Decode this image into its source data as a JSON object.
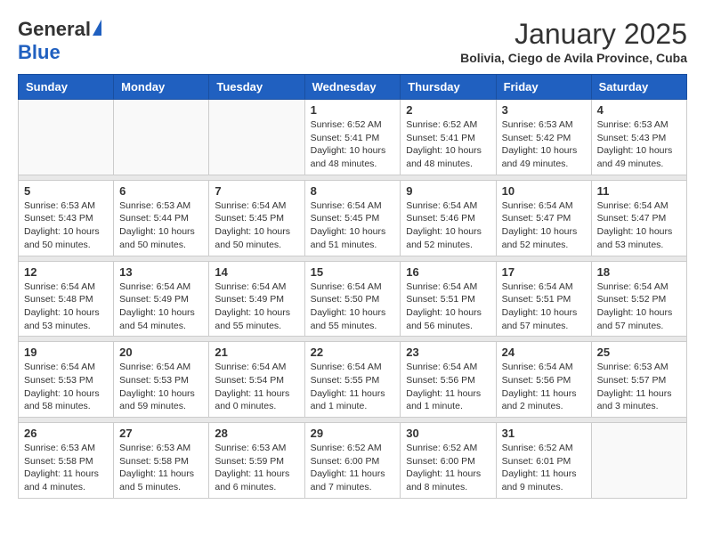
{
  "logo": {
    "general": "General",
    "blue": "Blue"
  },
  "title": "January 2025",
  "subtitle": "Bolivia, Ciego de Avila Province, Cuba",
  "headers": [
    "Sunday",
    "Monday",
    "Tuesday",
    "Wednesday",
    "Thursday",
    "Friday",
    "Saturday"
  ],
  "weeks": [
    {
      "days": [
        {
          "num": "",
          "info": ""
        },
        {
          "num": "",
          "info": ""
        },
        {
          "num": "",
          "info": ""
        },
        {
          "num": "1",
          "info": "Sunrise: 6:52 AM\nSunset: 5:41 PM\nDaylight: 10 hours\nand 48 minutes."
        },
        {
          "num": "2",
          "info": "Sunrise: 6:52 AM\nSunset: 5:41 PM\nDaylight: 10 hours\nand 48 minutes."
        },
        {
          "num": "3",
          "info": "Sunrise: 6:53 AM\nSunset: 5:42 PM\nDaylight: 10 hours\nand 49 minutes."
        },
        {
          "num": "4",
          "info": "Sunrise: 6:53 AM\nSunset: 5:43 PM\nDaylight: 10 hours\nand 49 minutes."
        }
      ]
    },
    {
      "days": [
        {
          "num": "5",
          "info": "Sunrise: 6:53 AM\nSunset: 5:43 PM\nDaylight: 10 hours\nand 50 minutes."
        },
        {
          "num": "6",
          "info": "Sunrise: 6:53 AM\nSunset: 5:44 PM\nDaylight: 10 hours\nand 50 minutes."
        },
        {
          "num": "7",
          "info": "Sunrise: 6:54 AM\nSunset: 5:45 PM\nDaylight: 10 hours\nand 50 minutes."
        },
        {
          "num": "8",
          "info": "Sunrise: 6:54 AM\nSunset: 5:45 PM\nDaylight: 10 hours\nand 51 minutes."
        },
        {
          "num": "9",
          "info": "Sunrise: 6:54 AM\nSunset: 5:46 PM\nDaylight: 10 hours\nand 52 minutes."
        },
        {
          "num": "10",
          "info": "Sunrise: 6:54 AM\nSunset: 5:47 PM\nDaylight: 10 hours\nand 52 minutes."
        },
        {
          "num": "11",
          "info": "Sunrise: 6:54 AM\nSunset: 5:47 PM\nDaylight: 10 hours\nand 53 minutes."
        }
      ]
    },
    {
      "days": [
        {
          "num": "12",
          "info": "Sunrise: 6:54 AM\nSunset: 5:48 PM\nDaylight: 10 hours\nand 53 minutes."
        },
        {
          "num": "13",
          "info": "Sunrise: 6:54 AM\nSunset: 5:49 PM\nDaylight: 10 hours\nand 54 minutes."
        },
        {
          "num": "14",
          "info": "Sunrise: 6:54 AM\nSunset: 5:49 PM\nDaylight: 10 hours\nand 55 minutes."
        },
        {
          "num": "15",
          "info": "Sunrise: 6:54 AM\nSunset: 5:50 PM\nDaylight: 10 hours\nand 55 minutes."
        },
        {
          "num": "16",
          "info": "Sunrise: 6:54 AM\nSunset: 5:51 PM\nDaylight: 10 hours\nand 56 minutes."
        },
        {
          "num": "17",
          "info": "Sunrise: 6:54 AM\nSunset: 5:51 PM\nDaylight: 10 hours\nand 57 minutes."
        },
        {
          "num": "18",
          "info": "Sunrise: 6:54 AM\nSunset: 5:52 PM\nDaylight: 10 hours\nand 57 minutes."
        }
      ]
    },
    {
      "days": [
        {
          "num": "19",
          "info": "Sunrise: 6:54 AM\nSunset: 5:53 PM\nDaylight: 10 hours\nand 58 minutes."
        },
        {
          "num": "20",
          "info": "Sunrise: 6:54 AM\nSunset: 5:53 PM\nDaylight: 10 hours\nand 59 minutes."
        },
        {
          "num": "21",
          "info": "Sunrise: 6:54 AM\nSunset: 5:54 PM\nDaylight: 11 hours\nand 0 minutes."
        },
        {
          "num": "22",
          "info": "Sunrise: 6:54 AM\nSunset: 5:55 PM\nDaylight: 11 hours\nand 1 minute."
        },
        {
          "num": "23",
          "info": "Sunrise: 6:54 AM\nSunset: 5:56 PM\nDaylight: 11 hours\nand 1 minute."
        },
        {
          "num": "24",
          "info": "Sunrise: 6:54 AM\nSunset: 5:56 PM\nDaylight: 11 hours\nand 2 minutes."
        },
        {
          "num": "25",
          "info": "Sunrise: 6:53 AM\nSunset: 5:57 PM\nDaylight: 11 hours\nand 3 minutes."
        }
      ]
    },
    {
      "days": [
        {
          "num": "26",
          "info": "Sunrise: 6:53 AM\nSunset: 5:58 PM\nDaylight: 11 hours\nand 4 minutes."
        },
        {
          "num": "27",
          "info": "Sunrise: 6:53 AM\nSunset: 5:58 PM\nDaylight: 11 hours\nand 5 minutes."
        },
        {
          "num": "28",
          "info": "Sunrise: 6:53 AM\nSunset: 5:59 PM\nDaylight: 11 hours\nand 6 minutes."
        },
        {
          "num": "29",
          "info": "Sunrise: 6:52 AM\nSunset: 6:00 PM\nDaylight: 11 hours\nand 7 minutes."
        },
        {
          "num": "30",
          "info": "Sunrise: 6:52 AM\nSunset: 6:00 PM\nDaylight: 11 hours\nand 8 minutes."
        },
        {
          "num": "31",
          "info": "Sunrise: 6:52 AM\nSunset: 6:01 PM\nDaylight: 11 hours\nand 9 minutes."
        },
        {
          "num": "",
          "info": ""
        }
      ]
    }
  ]
}
